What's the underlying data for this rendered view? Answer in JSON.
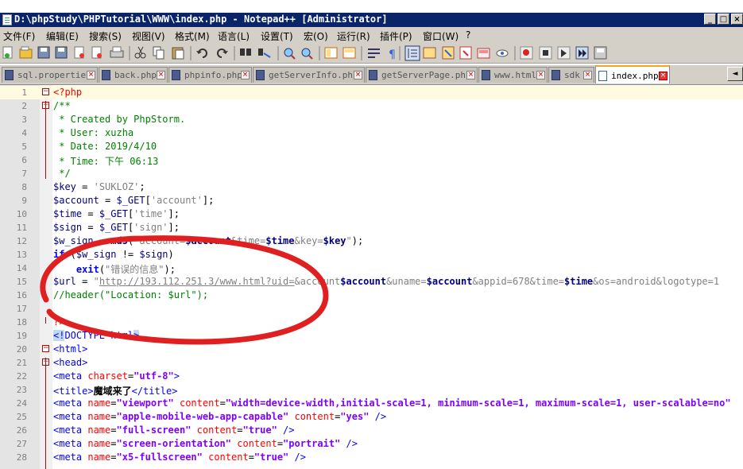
{
  "window": {
    "title": "D:\\phpStudy\\PHPTutorial\\WWW\\index.php - Notepad++ [Administrator]",
    "buttons": [
      "_",
      "□",
      "×"
    ]
  },
  "menu": [
    "文件(F)",
    "编辑(E)",
    "搜索(S)",
    "视图(V)",
    "格式(M)",
    "语言(L)",
    "设置(T)",
    "宏(O)",
    "运行(R)",
    "插件(P)",
    "窗口(W)",
    "?"
  ],
  "toolbar": {
    "icons": [
      "new-file-icon",
      "open-file-icon",
      "save-icon",
      "save-all-icon",
      "close-icon",
      "close-all-icon",
      "print-icon",
      "cut-icon",
      "copy-icon",
      "paste-icon",
      "undo-icon",
      "redo-icon",
      "find-icon",
      "replace-icon",
      "zoom-in-icon",
      "zoom-out-icon",
      "sync-vertical-icon",
      "sync-horizontal-icon",
      "word-wrap-icon",
      "show-all-chars-icon",
      "indent-guide-icon",
      "doc-map-icon",
      "function-list-icon",
      "folder-workspace-icon",
      "monitor-icon",
      "record-macro-icon",
      "stop-macro-icon",
      "play-macro-icon",
      "run-macro-multiple-icon",
      "save-macro-icon"
    ]
  },
  "tabs": [
    {
      "label": "sql.properties",
      "active": false
    },
    {
      "label": "back.php",
      "active": false
    },
    {
      "label": "phpinfo.php",
      "active": false
    },
    {
      "label": "getServerInfo.php",
      "active": false
    },
    {
      "label": "getServerPage.php",
      "active": false
    },
    {
      "label": "www.html",
      "active": false
    },
    {
      "label": "sdk",
      "active": false
    },
    {
      "label": "index.php",
      "active": true
    }
  ],
  "tab_scroll_label": "◄",
  "editor": {
    "lines": [
      {
        "n": "1",
        "spans": [
          [
            "php",
            "<?php"
          ]
        ]
      },
      {
        "n": "2",
        "spans": [
          [
            "cm",
            "/**"
          ]
        ]
      },
      {
        "n": "3",
        "spans": [
          [
            "cm",
            " * Created by PhpStorm."
          ]
        ]
      },
      {
        "n": "4",
        "spans": [
          [
            "cm",
            " * User: xuzha"
          ]
        ]
      },
      {
        "n": "5",
        "spans": [
          [
            "cm",
            " * Date: 2019/4/10"
          ]
        ]
      },
      {
        "n": "6",
        "spans": [
          [
            "cm",
            " * Time: 下午 06:13"
          ]
        ]
      },
      {
        "n": "7",
        "spans": [
          [
            "cm",
            " */"
          ]
        ]
      },
      {
        "n": "8",
        "spans": [
          [
            "v",
            "$key"
          ],
          [
            "plain",
            " = "
          ],
          [
            "str",
            "'SUKLOZ'"
          ],
          [
            "plain",
            ";"
          ]
        ]
      },
      {
        "n": "9",
        "spans": [
          [
            "v",
            "$account"
          ],
          [
            "plain",
            " = "
          ],
          [
            "v",
            "$_GET"
          ],
          [
            "plain",
            "["
          ],
          [
            "str",
            "'account'"
          ],
          [
            "plain",
            "];"
          ]
        ]
      },
      {
        "n": "10",
        "spans": [
          [
            "v",
            "$time"
          ],
          [
            "plain",
            " = "
          ],
          [
            "v",
            "$_GET"
          ],
          [
            "plain",
            "["
          ],
          [
            "str",
            "'time'"
          ],
          [
            "plain",
            "];"
          ]
        ]
      },
      {
        "n": "11",
        "spans": [
          [
            "v",
            "$sign"
          ],
          [
            "plain",
            " = "
          ],
          [
            "v",
            "$_GET"
          ],
          [
            "plain",
            "["
          ],
          [
            "str",
            "'sign'"
          ],
          [
            "plain",
            "];"
          ]
        ]
      },
      {
        "n": "12",
        "spans": [
          [
            "v",
            "$w_sign"
          ],
          [
            "plain",
            " = "
          ],
          [
            "fn",
            "md5"
          ],
          [
            "plain",
            "("
          ],
          [
            "str",
            "\"account="
          ],
          [
            "v bold",
            "$account"
          ],
          [
            "str",
            "&time="
          ],
          [
            "v bold",
            "$time"
          ],
          [
            "str",
            "&key="
          ],
          [
            "v bold",
            "$key"
          ],
          [
            "str",
            "\""
          ],
          [
            "plain",
            ");"
          ]
        ]
      },
      {
        "n": "13",
        "spans": [
          [
            "k",
            "if"
          ],
          [
            "plain",
            " ("
          ],
          [
            "v",
            "$w_sign"
          ],
          [
            "plain",
            " != "
          ],
          [
            "v",
            "$sign"
          ],
          [
            "plain",
            ")"
          ]
        ]
      },
      {
        "n": "14",
        "spans": [
          [
            "plain",
            "    "
          ],
          [
            "k",
            "exit"
          ],
          [
            "plain",
            "("
          ],
          [
            "str",
            "\"错误的信息\""
          ],
          [
            "plain",
            ");"
          ]
        ]
      },
      {
        "n": "15",
        "spans": [
          [
            "v",
            "$url"
          ],
          [
            "plain",
            " = "
          ],
          [
            "str",
            "\""
          ],
          [
            "u",
            "http://193.112.251.3/www.html?uid="
          ],
          [
            "str",
            "&account"
          ],
          [
            "v bold",
            "$account"
          ],
          [
            "str",
            "&uname="
          ],
          [
            "v bold",
            "$account"
          ],
          [
            "str",
            "&appid=678&time="
          ],
          [
            "v bold",
            "$time"
          ],
          [
            "str",
            "&os=android&logotype=1"
          ]
        ]
      },
      {
        "n": "16",
        "spans": [
          [
            "cm",
            "//header(\"Location: $url\");"
          ]
        ]
      },
      {
        "n": "17",
        "spans": []
      },
      {
        "n": "18",
        "spans": [
          [
            "php",
            "?>"
          ]
        ]
      },
      {
        "n": "19",
        "spans": [
          [
            "tag hl",
            "<!"
          ],
          [
            "tag",
            "DOCTYPE html"
          ],
          [
            "tag hl",
            ">"
          ]
        ]
      },
      {
        "n": "20",
        "spans": [
          [
            "tag",
            "<html>"
          ]
        ]
      },
      {
        "n": "21",
        "spans": [
          [
            "tag",
            "<head>"
          ]
        ]
      },
      {
        "n": "22",
        "spans": [
          [
            "tag",
            "<meta "
          ],
          [
            "attr",
            "charset"
          ],
          [
            "plain",
            "="
          ],
          [
            "aval",
            "\"utf-8\""
          ],
          [
            "tag",
            ">"
          ]
        ]
      },
      {
        "n": "23",
        "spans": [
          [
            "tag",
            "<title>"
          ],
          [
            "plain bold",
            "魔域来了"
          ],
          [
            "tag",
            "</title>"
          ]
        ]
      },
      {
        "n": "24",
        "spans": [
          [
            "tag",
            "<meta "
          ],
          [
            "attr",
            "name"
          ],
          [
            "plain",
            "="
          ],
          [
            "aval",
            "\"viewport\""
          ],
          [
            "plain",
            " "
          ],
          [
            "attr",
            "content"
          ],
          [
            "plain",
            "="
          ],
          [
            "aval",
            "\"width=device-width,initial-scale=1, minimum-scale=1, maximum-scale=1, user-scalable=no\""
          ]
        ]
      },
      {
        "n": "25",
        "spans": [
          [
            "tag",
            "<meta "
          ],
          [
            "attr",
            "name"
          ],
          [
            "plain",
            "="
          ],
          [
            "aval",
            "\"apple-mobile-web-app-capable\""
          ],
          [
            "plain",
            " "
          ],
          [
            "attr",
            "content"
          ],
          [
            "plain",
            "="
          ],
          [
            "aval",
            "\"yes\""
          ],
          [
            "tag",
            " />"
          ]
        ]
      },
      {
        "n": "26",
        "spans": [
          [
            "tag",
            "<meta "
          ],
          [
            "attr",
            "name"
          ],
          [
            "plain",
            "="
          ],
          [
            "aval",
            "\"full-screen\""
          ],
          [
            "plain",
            " "
          ],
          [
            "attr",
            "content"
          ],
          [
            "plain",
            "="
          ],
          [
            "aval",
            "\"true\""
          ],
          [
            "tag",
            " />"
          ]
        ]
      },
      {
        "n": "27",
        "spans": [
          [
            "tag",
            "<meta "
          ],
          [
            "attr",
            "name"
          ],
          [
            "plain",
            "="
          ],
          [
            "aval",
            "\"screen-orientation\""
          ],
          [
            "plain",
            " "
          ],
          [
            "attr",
            "content"
          ],
          [
            "plain",
            "="
          ],
          [
            "aval",
            "\"portrait\""
          ],
          [
            "tag",
            " />"
          ]
        ]
      },
      {
        "n": "28",
        "spans": [
          [
            "tag",
            "<meta "
          ],
          [
            "attr",
            "name"
          ],
          [
            "plain",
            "="
          ],
          [
            "aval",
            "\"x5-fullscreen\""
          ],
          [
            "plain",
            " "
          ],
          [
            "attr",
            "content"
          ],
          [
            "plain",
            "="
          ],
          [
            "aval",
            "\"true\""
          ],
          [
            "tag",
            " />"
          ]
        ]
      }
    ]
  },
  "colors": {
    "title_bar": "#0a246a",
    "annotation_circle": "#e02020",
    "current_line": "#fffbe0"
  }
}
